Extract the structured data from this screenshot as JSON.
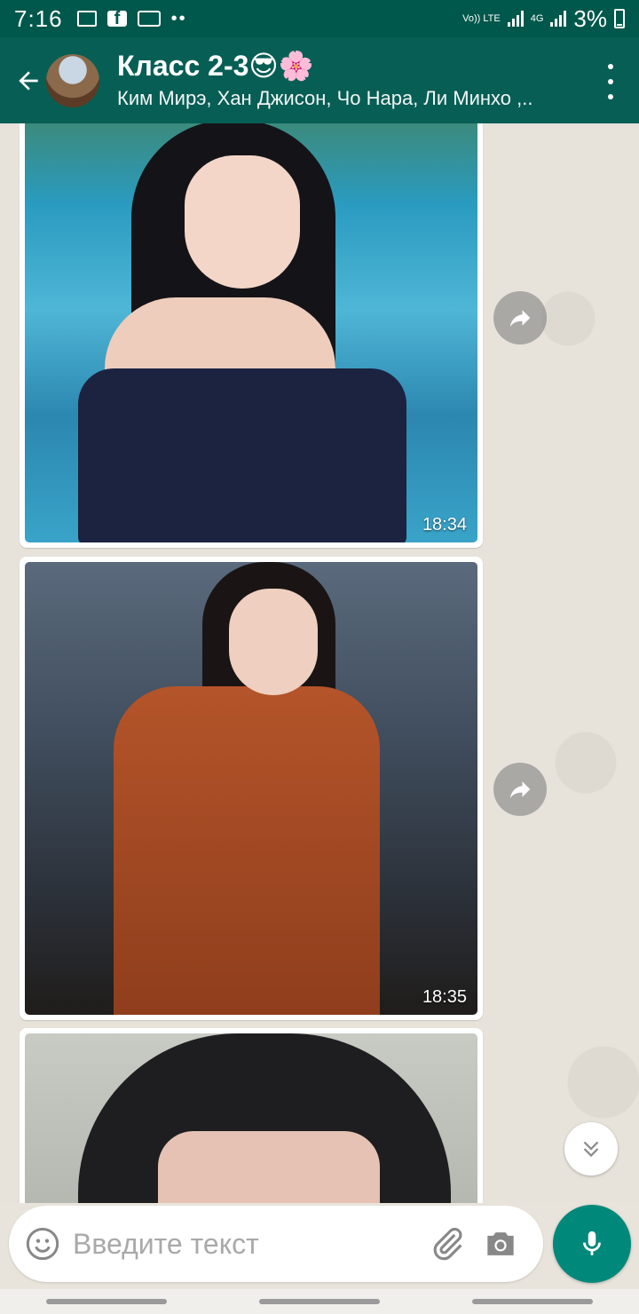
{
  "status_bar": {
    "time": "7:16",
    "volte_label": "Vo)) LTE",
    "network_label": "4G",
    "battery": "3%"
  },
  "header": {
    "title": "Класс 2-3😎🌸",
    "subtitle": "Ким Мирэ, Хан Джисон, Чо Нара, Ли Минхо ,.."
  },
  "messages": [
    {
      "type": "image",
      "time": "18:34"
    },
    {
      "type": "image",
      "time": "18:35"
    },
    {
      "type": "image",
      "time": ""
    }
  ],
  "composer": {
    "placeholder": "Введите текст"
  },
  "colors": {
    "header": "#075e54",
    "status_bar": "#00574b",
    "accent": "#00897b"
  }
}
